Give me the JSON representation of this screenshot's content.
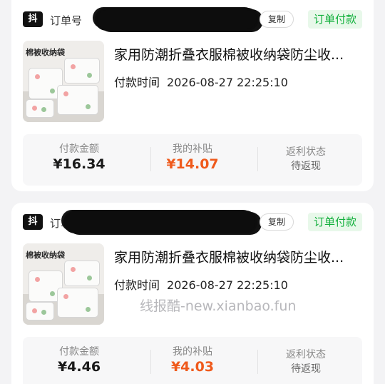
{
  "orders": [
    {
      "platform_badge": "抖",
      "order_label": "订单号",
      "copy_label": "复制",
      "status": "订单付款",
      "thumb_caption": "棉被收纳袋",
      "title": "家用防潮折叠衣服棉被收纳袋防尘收...",
      "paytime_label": "付款时间",
      "paytime_value": "2026-08-27 22:25:10",
      "pay_amount_label": "付款金额",
      "pay_amount": "¥16.34",
      "subsidy_label": "我的补贴",
      "subsidy": "¥14.07",
      "rebate_label": "返利状态",
      "rebate_status": "待返现"
    },
    {
      "platform_badge": "抖",
      "order_label": "订单号",
      "copy_label": "复制",
      "status": "订单付款",
      "thumb_caption": "棉被收纳袋",
      "title": "家用防潮折叠衣服棉被收纳袋防尘收...",
      "paytime_label": "付款时间",
      "paytime_value": "2026-08-27 22:25:10",
      "pay_amount_label": "付款金额",
      "pay_amount": "¥4.46",
      "subsidy_label": "我的补贴",
      "subsidy": "¥4.03",
      "rebate_label": "返利状态",
      "rebate_status": "待返现"
    }
  ],
  "watermark": "线报酷-new.xianbao.fun",
  "colors": {
    "status_green": "#12b03c",
    "status_bg": "#e8f8ea",
    "subsidy_orange": "#ef5a1c",
    "page_bg": "#f3f3f5"
  }
}
